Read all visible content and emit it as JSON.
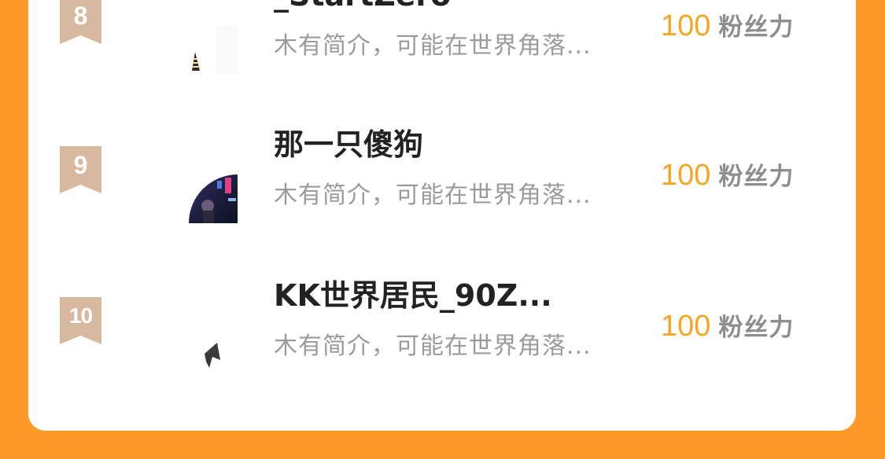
{
  "ranking": {
    "rows": [
      {
        "rank": "8",
        "nickname": "_StartZero",
        "intro": "木有简介，可能在世界角落...",
        "score": "100",
        "score_unit": "粉丝力"
      },
      {
        "rank": "9",
        "nickname": "那一只傻狗",
        "intro": "木有简介，可能在世界角落...",
        "score": "100",
        "score_unit": "粉丝力"
      },
      {
        "rank": "10",
        "nickname": "KK世界居民_90Z...",
        "intro": "木有简介，可能在世界角落...",
        "score": "100",
        "score_unit": "粉丝力"
      }
    ]
  },
  "colors": {
    "page_background": "#fe9a27",
    "rank_badge": "#d7b9a0",
    "score": "#f5a623",
    "intro_text": "#9b9b9b"
  }
}
